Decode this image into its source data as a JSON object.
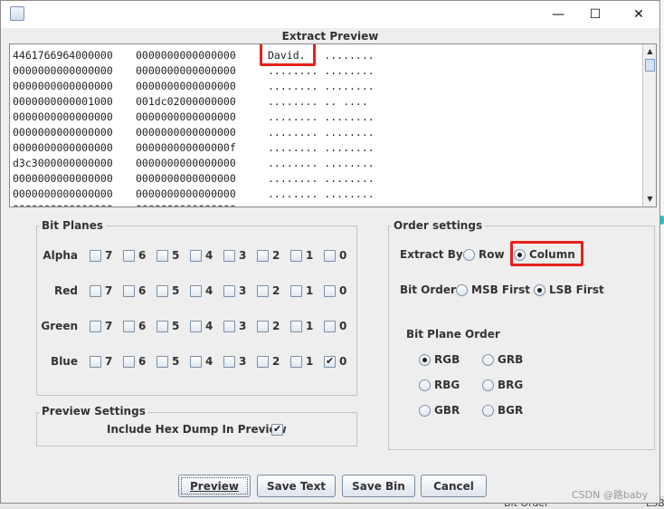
{
  "window": {
    "title": "Extract Preview",
    "minimize_glyph": "—",
    "maximize_glyph": "☐",
    "close_glyph": "✕"
  },
  "preview": {
    "rows": [
      {
        "a": "4461766964000000",
        "b": "0000000000000000",
        "c": "David. . ........"
      },
      {
        "a": "0000000000000000",
        "b": "0000000000000000",
        "c": "........ ........"
      },
      {
        "a": "0000000000000000",
        "b": "0000000000000000",
        "c": "........ ........"
      },
      {
        "a": "0000000000001000",
        "b": "001dc02000000000",
        "c": "........ .. ...."
      },
      {
        "a": "0000000000000000",
        "b": "0000000000000000",
        "c": "........ ........"
      },
      {
        "a": "0000000000000000",
        "b": "0000000000000000",
        "c": "........ ........"
      },
      {
        "a": "0000000000000000",
        "b": "000000000000000f",
        "c": "........ ........"
      },
      {
        "a": "d3c3000000000000",
        "b": "0000000000000000",
        "c": "........ ........"
      },
      {
        "a": "0000000000000000",
        "b": "0000000000000000",
        "c": "........ ........"
      },
      {
        "a": "0000000000000000",
        "b": "0000000000000000",
        "c": "........ ........"
      },
      {
        "a": "0000000000000000",
        "b": "0000000000000000",
        "c": "........ ........"
      }
    ]
  },
  "bit_planes": {
    "label": "Bit Planes",
    "bits": [
      "7",
      "6",
      "5",
      "4",
      "3",
      "2",
      "1",
      "0"
    ],
    "rows": [
      {
        "label": "Alpha",
        "checked": [
          false,
          false,
          false,
          false,
          false,
          false,
          false,
          false
        ]
      },
      {
        "label": "Red",
        "checked": [
          false,
          false,
          false,
          false,
          false,
          false,
          false,
          false
        ]
      },
      {
        "label": "Green",
        "checked": [
          false,
          false,
          false,
          false,
          false,
          false,
          false,
          false
        ]
      },
      {
        "label": "Blue",
        "checked": [
          false,
          false,
          false,
          false,
          false,
          false,
          false,
          true
        ]
      }
    ]
  },
  "preview_settings": {
    "label": "Preview Settings",
    "include_hex_label": "Include Hex Dump In Preview",
    "include_hex_checked": true
  },
  "order_settings": {
    "label": "Order settings",
    "extract_by_label": "Extract By",
    "extract_by_options": [
      "Row",
      "Column"
    ],
    "extract_by_selected": "Column",
    "bit_order_label": "Bit Order",
    "bit_order_options": [
      "MSB First",
      "LSB First"
    ],
    "bit_order_selected": "LSB First",
    "plane_order_label": "Bit Plane Order",
    "plane_order_options": [
      "RGB",
      "GRB",
      "RBG",
      "BRG",
      "GBR",
      "BGR"
    ],
    "plane_order_selected": "RGB"
  },
  "buttons": {
    "preview": "Preview",
    "save_text": "Save Text",
    "save_bin": "Save Bin",
    "cancel": "Cancel"
  },
  "backdrop": {
    "bit_order_text": "Bit Order",
    "lsb_text": "LSB"
  },
  "watermark": "CSDN @路baby",
  "colors": {
    "highlight": "#e8201c",
    "teal": "#27c3c3"
  }
}
